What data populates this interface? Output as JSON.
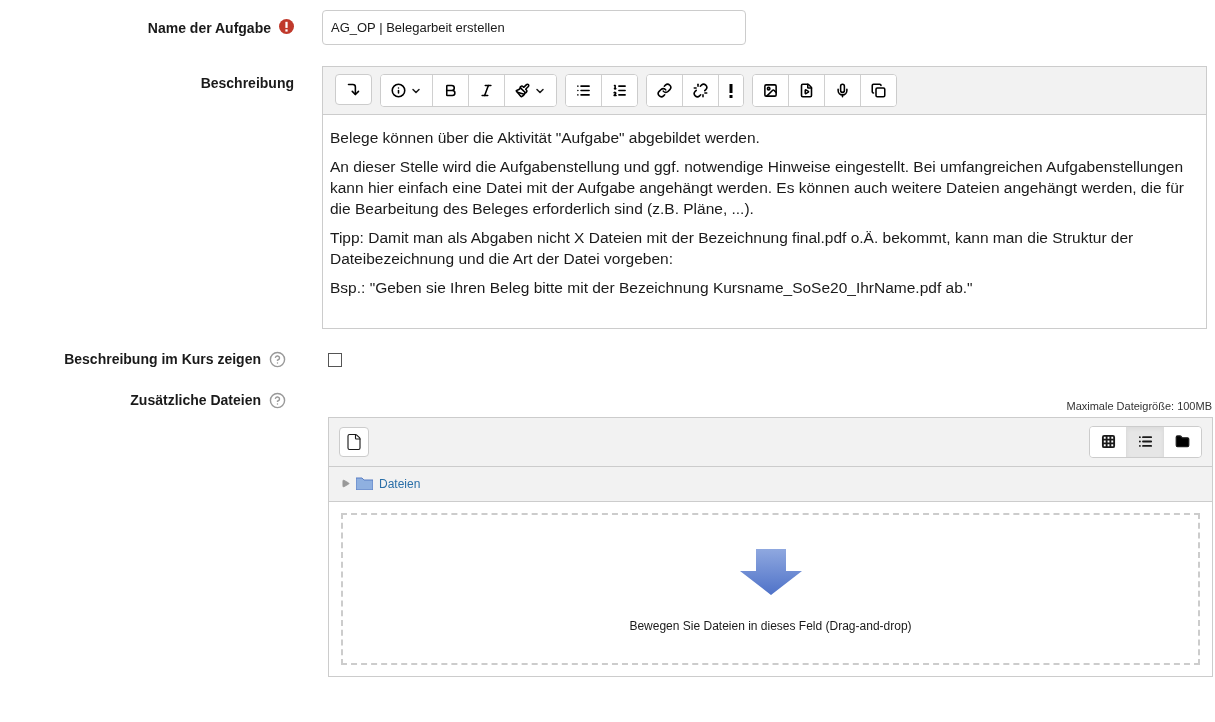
{
  "name_field": {
    "label": "Name der Aufgabe",
    "required": true,
    "value": "AG_OP | Belegarbeit erstellen"
  },
  "description": {
    "label": "Beschreibung",
    "toolbar_groups": [
      [
        {
          "kind": "collapse"
        }
      ],
      [
        {
          "kind": "info"
        },
        {
          "kind": "bold"
        },
        {
          "kind": "italic"
        },
        {
          "kind": "brush"
        }
      ],
      [
        {
          "kind": "bullets"
        },
        {
          "kind": "numbers"
        }
      ],
      [
        {
          "kind": "link"
        },
        {
          "kind": "unlink"
        },
        {
          "kind": "exclamation"
        }
      ],
      [
        {
          "kind": "image"
        },
        {
          "kind": "video"
        },
        {
          "kind": "mic"
        },
        {
          "kind": "copy"
        }
      ]
    ],
    "paragraphs": [
      "Belege können über die Aktivität \"Aufgabe\" abgebildet werden.",
      "An dieser Stelle wird die Aufgabenstellung und ggf. notwendige Hinweise eingestellt. Bei umfangreichen Aufgabenstellungen kann hier einfach eine Datei mit der Aufgabe angehängt werden. Es können auch weitere Dateien angehängt werden, die für die Bearbeitung des Beleges erforderlich sind (z.B. Pläne, ...).",
      "Tipp: Damit man als Abgaben nicht X Dateien mit der Bezeichnung final.pdf o.Ä. bekommt, kann man die Struktur der Dateibezeichnung und die Art der Datei vorgeben:",
      "Bsp.: \"Geben sie Ihren Beleg bitte mit der Bezeichnung Kursname_SoSe20_IhrName.pdf ab.\""
    ]
  },
  "show_in_course": {
    "label": "Beschreibung im Kurs zeigen",
    "checked": false
  },
  "files": {
    "label": "Zusätzliche Dateien",
    "max_size": "Maximale Dateigröße: 100MB",
    "views": [
      {
        "kind": "grid",
        "selected": false
      },
      {
        "kind": "list",
        "selected": true
      },
      {
        "kind": "tree",
        "selected": false
      }
    ],
    "folder": "Dateien",
    "drop_hint": "Bewegen Sie Dateien in dieses Feld (Drag-and-drop)"
  }
}
